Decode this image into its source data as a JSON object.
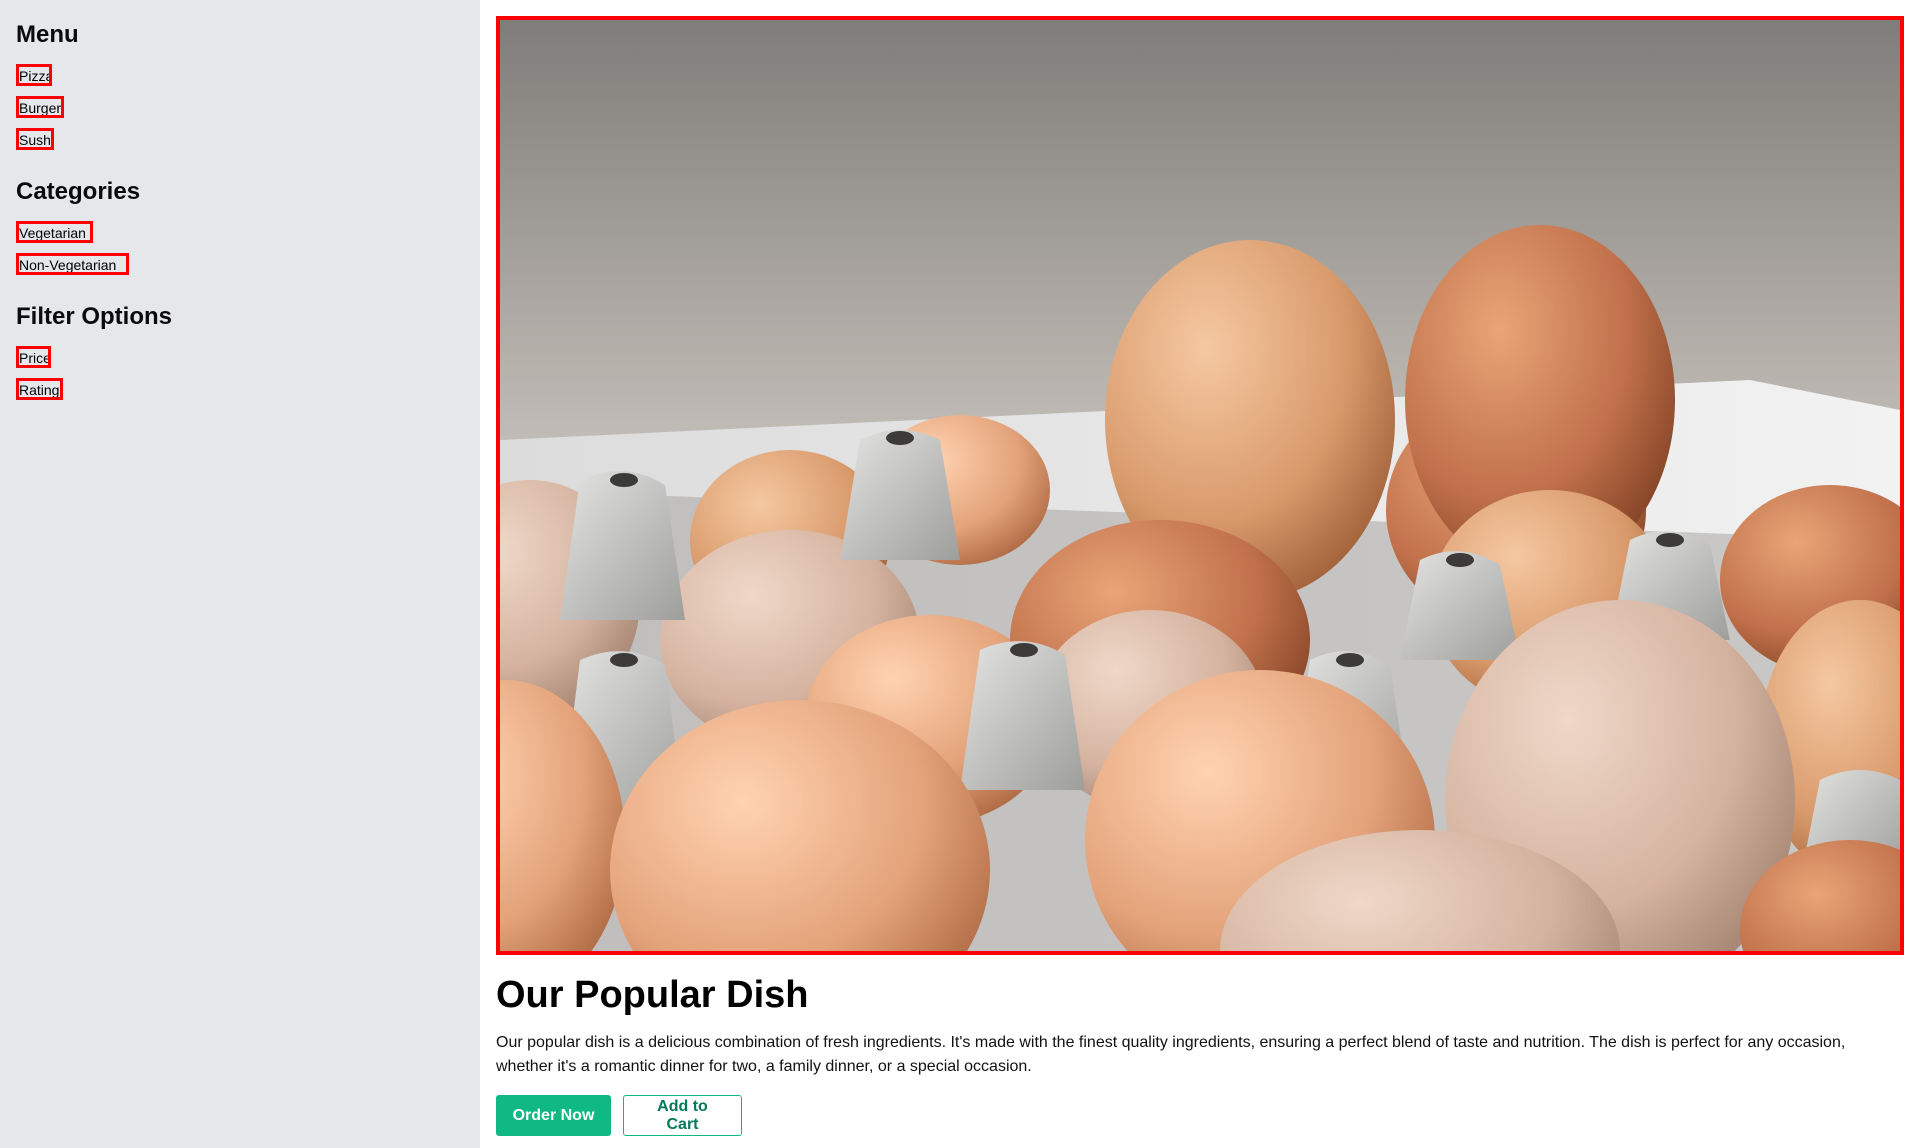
{
  "sidebar": {
    "sections": [
      {
        "title": "Menu",
        "items": [
          "Pizza",
          "Burger",
          "Sushi"
        ]
      },
      {
        "title": "Categories",
        "items": [
          "Vegetarian",
          "Non-Vegetarian"
        ]
      },
      {
        "title": "Filter Options",
        "items": [
          "Price",
          "Rating"
        ]
      }
    ]
  },
  "main": {
    "hero_image": "eggs-in-carton-photo",
    "title": "Our Popular Dish",
    "description": "Our popular dish is a delicious combination of fresh ingredients. It's made with the finest quality ingredients, ensuring a perfect blend of taste and nutrition. The dish is perfect for any occasion, whether it's a romantic dinner for two, a family dinner, or a special occasion.",
    "actions": {
      "order_label": "Order Now",
      "cart_label": "Add to Cart"
    }
  },
  "colors": {
    "sidebar_bg": "#e6e7eb",
    "accent": "#10b981",
    "accent_dark": "#047857",
    "highlight_border": "#ff0000"
  }
}
